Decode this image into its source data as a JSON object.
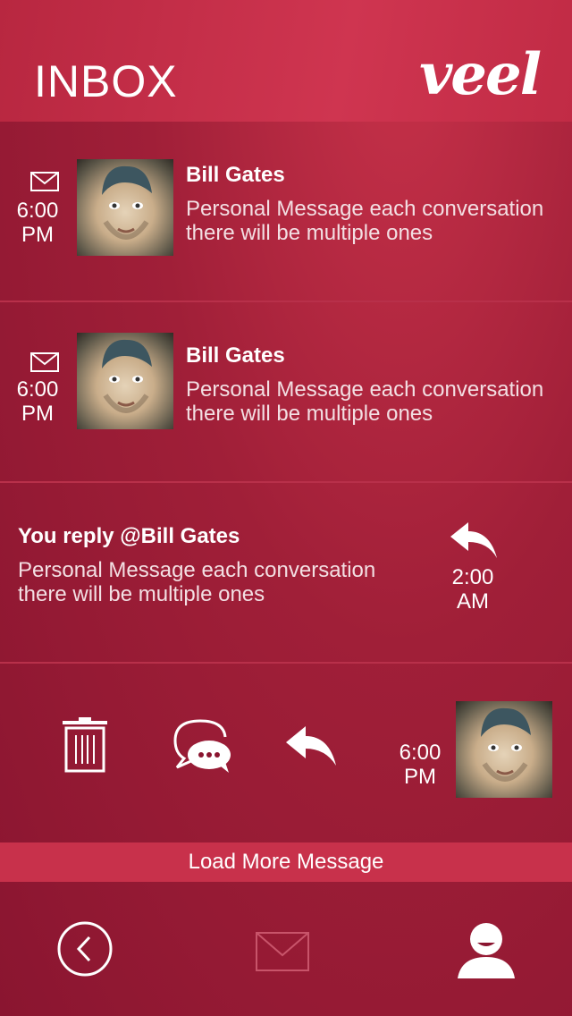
{
  "header": {
    "title": "INBOX",
    "logo": "veel"
  },
  "messages": [
    {
      "time": "6:00",
      "meridiem": "PM",
      "sender": "Bill Gates",
      "line1": "Personal Message each conversation",
      "line2": "there will be multiple ones"
    },
    {
      "time": "6:00",
      "meridiem": "PM",
      "sender": "Bill Gates",
      "line1": "Personal Message each conversation",
      "line2": "there will be multiple ones"
    }
  ],
  "reply": {
    "title": "You reply @Bill Gates",
    "line1": "Personal Message each conversation",
    "line2": "there will be multiple ones",
    "time": "2:00",
    "meridiem": "AM"
  },
  "action_row": {
    "time": "6:00",
    "meridiem": "PM",
    "icons": [
      "trash-icon",
      "chat-bubbles-icon",
      "reply-icon"
    ]
  },
  "load_more": "Load More Message",
  "bottom_nav": {
    "icons": [
      "back-icon",
      "mail-icon",
      "profile-icon"
    ]
  },
  "colors": {
    "accent": "#c8314b",
    "background": "#8a1530",
    "header": "#cf3550"
  }
}
